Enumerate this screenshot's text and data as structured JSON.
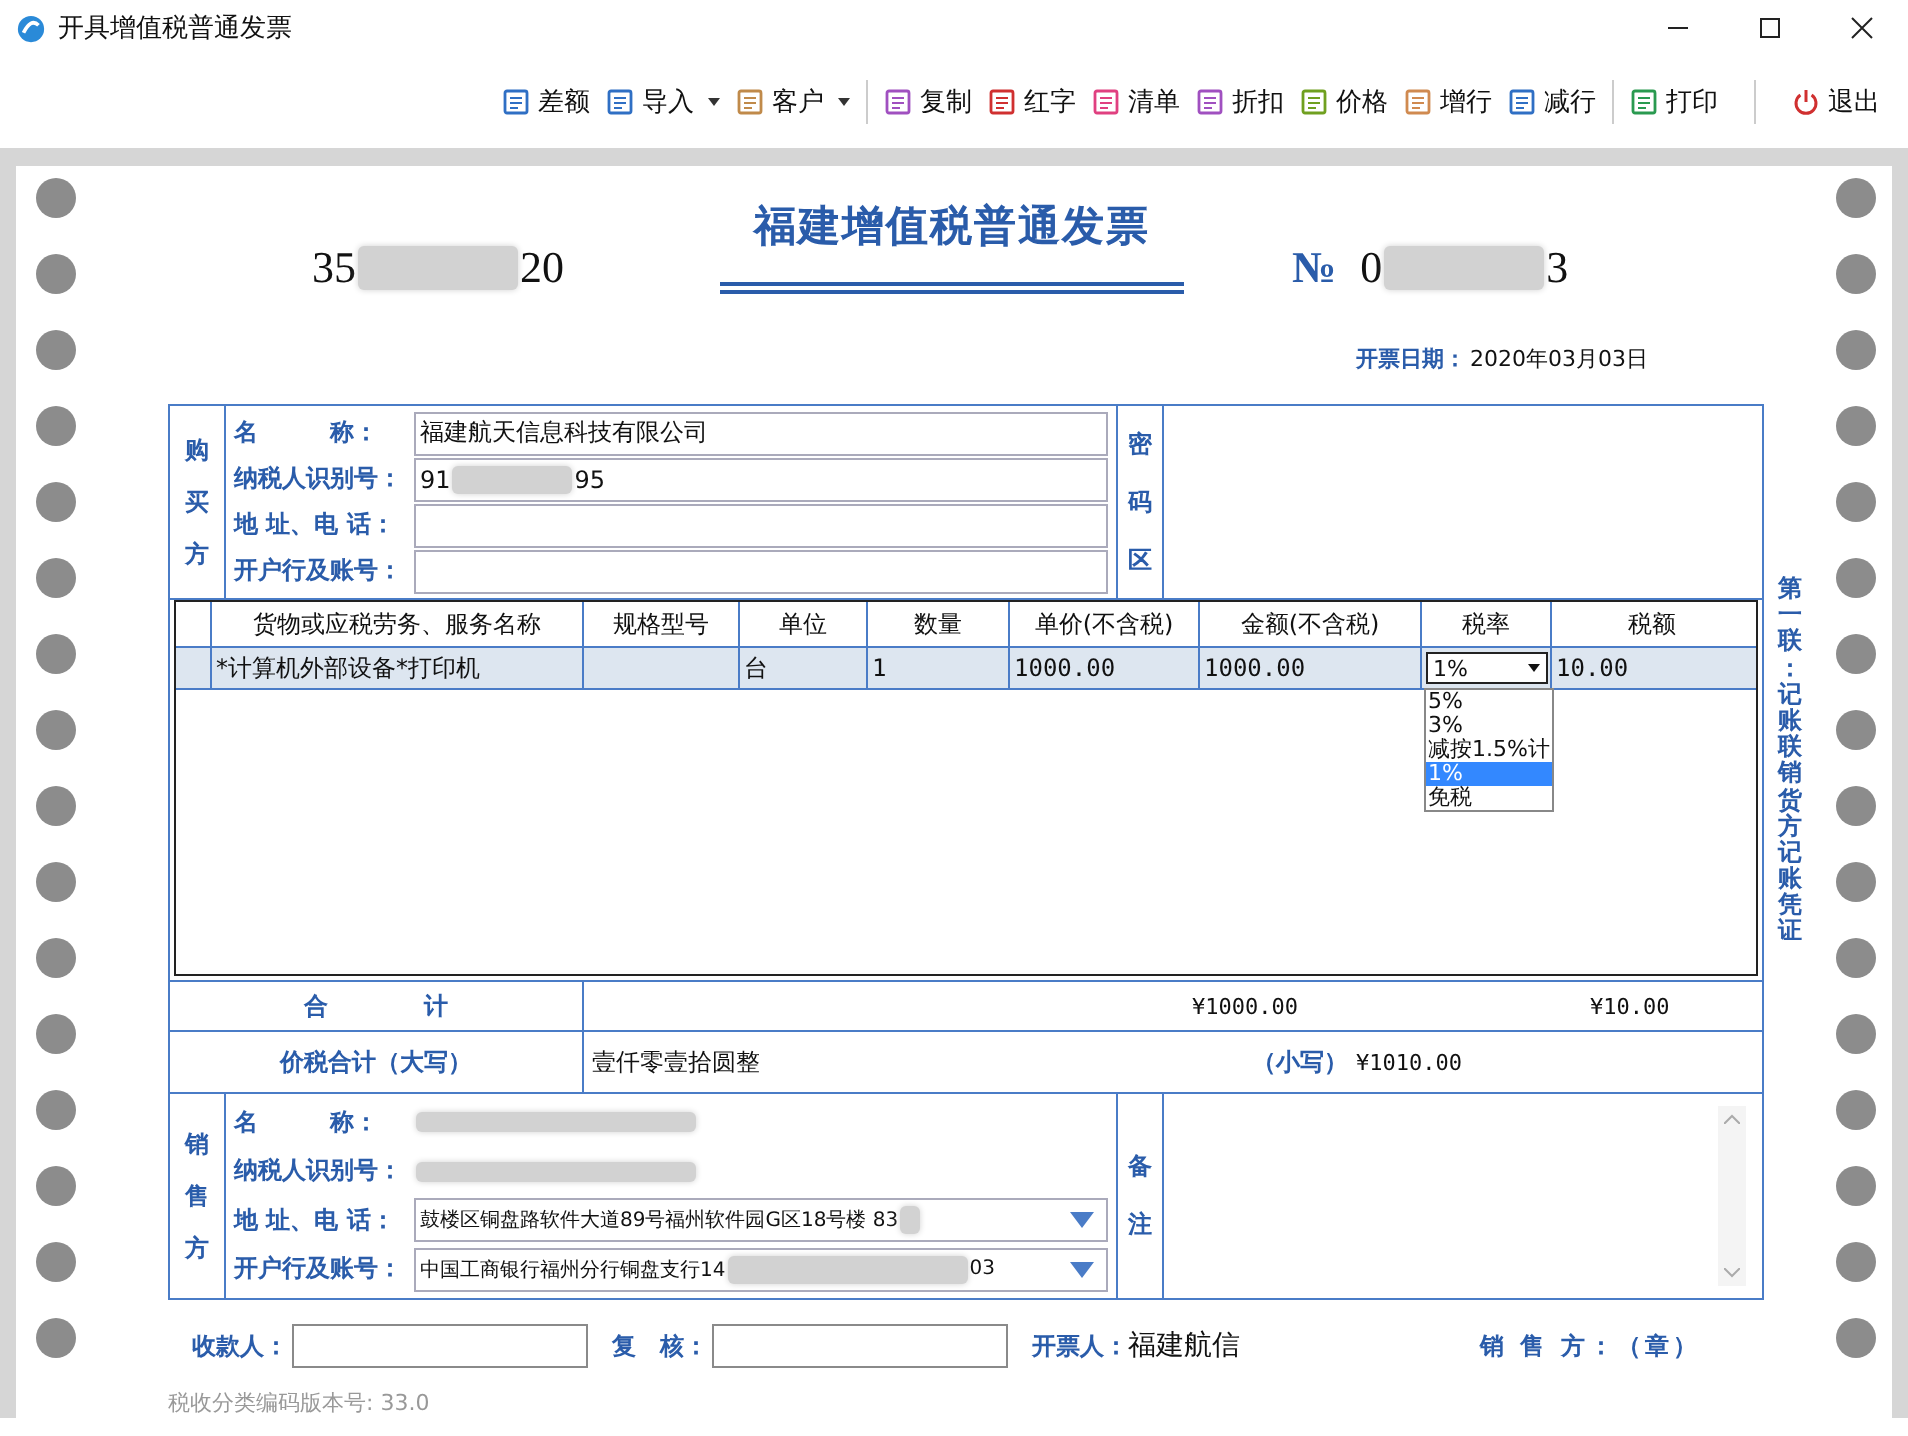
{
  "window": {
    "title": "开具增值税普通发票"
  },
  "toolbar": [
    [
      {
        "label": "差额",
        "kind": "tool",
        "color": "#2f6fc4",
        "dropdown": false
      },
      {
        "label": "导入",
        "kind": "tool",
        "color": "#2f6fc4",
        "dropdown": true
      },
      {
        "label": "客户",
        "kind": "tool",
        "color": "#c08a4a",
        "dropdown": true
      }
    ],
    [
      {
        "label": "复制",
        "kind": "tool",
        "color": "#a050c0",
        "dropdown": false
      },
      {
        "label": "红字",
        "kind": "tool",
        "color": "#d03030",
        "dropdown": false
      },
      {
        "label": "清单",
        "kind": "tool",
        "color": "#e04080",
        "dropdown": false
      },
      {
        "label": "折扣",
        "kind": "tool",
        "color": "#a050c0",
        "dropdown": false
      },
      {
        "label": "价格",
        "kind": "tool",
        "color": "#70a020",
        "dropdown": false
      },
      {
        "label": "增行",
        "kind": "tool",
        "color": "#d08a50",
        "dropdown": false
      },
      {
        "label": "减行",
        "kind": "tool",
        "color": "#2f6fc4",
        "dropdown": false
      }
    ],
    [
      {
        "label": "打印",
        "kind": "tool",
        "color": "#2a9a50",
        "dropdown": false
      }
    ],
    [
      {
        "label": "退出",
        "kind": "exit",
        "color": "#d03030",
        "dropdown": false
      }
    ]
  ],
  "invoice": {
    "title": "福建增值税普通发票",
    "code_prefix": "35",
    "code_suffix": "20",
    "number_mark": "№",
    "number_prefix": "0",
    "number_suffix": "3",
    "date_label": "开票日期：",
    "date": "2020年03月03日"
  },
  "buyer": {
    "section_label": "购买方",
    "cipher_label": "密码区",
    "fields": [
      {
        "label": "名　　　称：",
        "value": "福建航天信息科技有限公司",
        "redacted": false
      },
      {
        "label": "纳税人识别号：",
        "value": "91",
        "value_suffix": "95",
        "redacted": true
      },
      {
        "label": "地 址、电 话：",
        "redacted": false
      },
      {
        "label": "开户行及账号：",
        "redacted": false
      }
    ]
  },
  "items": {
    "columns": [
      "货物或应税劳务、服务名称",
      "规格型号",
      "单位",
      "数量",
      "单价(不含税)",
      "金额(不含税)",
      "税率",
      "税额"
    ],
    "rows": [
      {
        "name": "*计算机外部设备*打印机",
        "unit": "台",
        "quantity": "1",
        "unit_price": "1000.00",
        "amount": "1000.00",
        "tax_rate": "1%",
        "tax": "10.00",
        "selected": true
      }
    ],
    "rate_options": [
      {
        "label": "5%",
        "selected": false
      },
      {
        "label": "3%",
        "selected": false
      },
      {
        "label": "减按1.5%计",
        "selected": false
      },
      {
        "label": "1%",
        "selected": true
      },
      {
        "label": "免税",
        "selected": false
      }
    ]
  },
  "totals": {
    "label": "合　　　　计",
    "amount": "¥1000.00",
    "tax": "¥10.00"
  },
  "grand_total": {
    "label": "价税合计（大写）",
    "words": "壹仟零壹拾圆整",
    "small_label": "（小写）",
    "small": "¥1010.00"
  },
  "seller": {
    "section_label": "销售方",
    "remark_label": "备注",
    "fields": [
      {
        "label": "名　　　称：",
        "kind": "plain",
        "redacted": true
      },
      {
        "label": "纳税人识别号：",
        "kind": "plain",
        "redacted": true
      },
      {
        "label": "地 址、电 话：",
        "kind": "combo",
        "value": "鼓楼区铜盘路软件大道89号福州软件园G区18号楼 83",
        "redacted": true
      },
      {
        "label": "开户行及账号：",
        "kind": "combo",
        "value": "中国工商银行福州分行铜盘支行14",
        "value_suffix": "03",
        "redacted": true
      }
    ]
  },
  "signatures": [
    {
      "label": "收款人：",
      "kind": "input"
    },
    {
      "label": "复　核：",
      "kind": "input"
    },
    {
      "label": "开票人：",
      "kind": "text",
      "value": "福建航信"
    },
    {
      "label": "销 售 方：（章）",
      "kind": "stamp"
    }
  ],
  "copy_label": "第一联：记账联销货方记账凭证",
  "version": "税收分类编码版本号: 33.0"
}
